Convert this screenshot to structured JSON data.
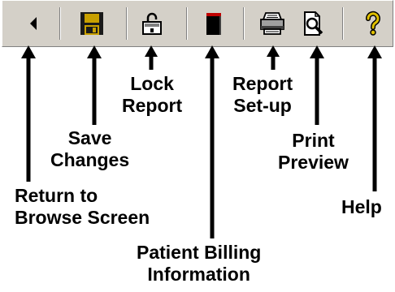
{
  "toolbar": {
    "buttons": [
      {
        "id": "back",
        "icon": "left-arrow-icon"
      },
      {
        "id": "save",
        "icon": "floppy-disk-icon"
      },
      {
        "id": "lock",
        "icon": "padlock-icon"
      },
      {
        "id": "billing",
        "icon": "billing-book-icon"
      },
      {
        "id": "setup",
        "icon": "printer-icon"
      },
      {
        "id": "preview",
        "icon": "print-preview-icon"
      },
      {
        "id": "help",
        "icon": "question-mark-icon"
      }
    ]
  },
  "callouts": {
    "return": {
      "line1": "Return to",
      "line2": "Browse Screen"
    },
    "save": {
      "line1": "Save",
      "line2": "Changes"
    },
    "lock": {
      "line1": "Lock",
      "line2": "Report"
    },
    "billing": {
      "line1": "Patient Billing",
      "line2": "Information"
    },
    "setup": {
      "line1": "Report",
      "line2": "Set-up"
    },
    "preview": {
      "line1": "Print",
      "line2": "Preview"
    },
    "help": {
      "line1": "Help"
    }
  },
  "colors": {
    "toolbar_bg": "#d4d0c8",
    "arrow": "#000000",
    "floppy": "#1a1a1a",
    "floppy_label": "#c8a000",
    "question_mark": "#e0c000",
    "billing_top": "#c00000"
  }
}
